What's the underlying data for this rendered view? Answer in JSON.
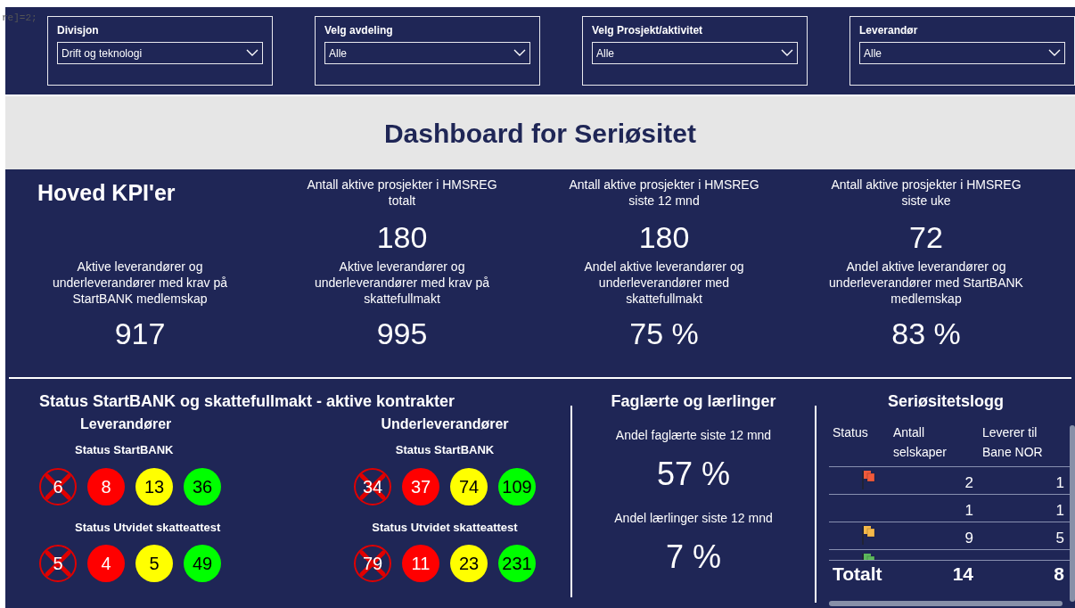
{
  "corner_text": "re]=2;",
  "filters": [
    {
      "label": "Divisjon",
      "value": "Drift og teknologi"
    },
    {
      "label": "Velg avdeling",
      "value": "Alle"
    },
    {
      "label": "Velg Prosjekt/aktivitet",
      "value": "Alle"
    },
    {
      "label": "Leverandør",
      "value": "Alle"
    }
  ],
  "title": "Dashboard for Seriøsitet",
  "kpi_heading": "Hoved KPI'er",
  "kpis_top": [
    {
      "label": "Antall aktive prosjekter i HMSREG totalt",
      "value": "180"
    },
    {
      "label": "Antall aktive prosjekter i HMSREG siste 12 mnd",
      "value": "180"
    },
    {
      "label": "Antall aktive prosjekter i HMSREG siste uke",
      "value": "72"
    }
  ],
  "kpis_bottom": [
    {
      "label": "Aktive leverandører og underleverandører med krav på StartBANK medlemskap",
      "value": "917"
    },
    {
      "label": "Aktive leverandører og underleverandører med krav på skattefullmakt",
      "value": "995"
    },
    {
      "label": "Andel aktive leverandører og underleverandører med skattefullmakt",
      "value": "75 %"
    },
    {
      "label": "Andel aktive leverandører og underleverandører med StartBANK medlemskap",
      "value": "83 %"
    }
  ],
  "status": {
    "title": "Status StartBANK og skattefullmakt - aktive kontrakter",
    "groups": [
      {
        "title": "Leverandører",
        "sections": [
          {
            "title": "Status StartBANK",
            "counts": [
              {
                "kind": "crossed",
                "value": "6"
              },
              {
                "kind": "red",
                "value": "8"
              },
              {
                "kind": "yellow",
                "value": "13"
              },
              {
                "kind": "green",
                "value": "36"
              }
            ]
          },
          {
            "title": "Status Utvidet skatteattest",
            "counts": [
              {
                "kind": "crossed",
                "value": "5"
              },
              {
                "kind": "red",
                "value": "4"
              },
              {
                "kind": "yellow",
                "value": "5"
              },
              {
                "kind": "green",
                "value": "49"
              }
            ]
          }
        ]
      },
      {
        "title": "Underleverandører",
        "sections": [
          {
            "title": "Status StartBANK",
            "counts": [
              {
                "kind": "crossed",
                "value": "34"
              },
              {
                "kind": "red",
                "value": "37"
              },
              {
                "kind": "yellow",
                "value": "74"
              },
              {
                "kind": "green",
                "value": "109"
              }
            ]
          },
          {
            "title": "Status Utvidet skatteattest",
            "counts": [
              {
                "kind": "crossed",
                "value": "79"
              },
              {
                "kind": "red",
                "value": "11"
              },
              {
                "kind": "yellow",
                "value": "23"
              },
              {
                "kind": "green",
                "value": "231"
              }
            ]
          }
        ]
      }
    ]
  },
  "skilled": {
    "title": "Faglærte og lærlinger",
    "items": [
      {
        "label": "Andel faglærte siste 12 mnd",
        "value": "57 %"
      },
      {
        "label": "Andel lærlinger siste 12 mnd",
        "value": "7 %"
      }
    ]
  },
  "log": {
    "title": "Seriøsitetslogg",
    "columns": [
      "Status",
      "Antall selskaper",
      "Leverer til Bane NOR"
    ],
    "rows": [
      {
        "color": "#f05a3c",
        "count": "2",
        "bane_nor": "1"
      },
      {
        "count": "1",
        "bane_nor": "1"
      },
      {
        "color": "#f5b94a",
        "count": "9",
        "bane_nor": "5"
      },
      {
        "color": "#5cb85c"
      }
    ],
    "total": {
      "label": "Totalt",
      "count": "14",
      "bane_nor": "8"
    }
  }
}
